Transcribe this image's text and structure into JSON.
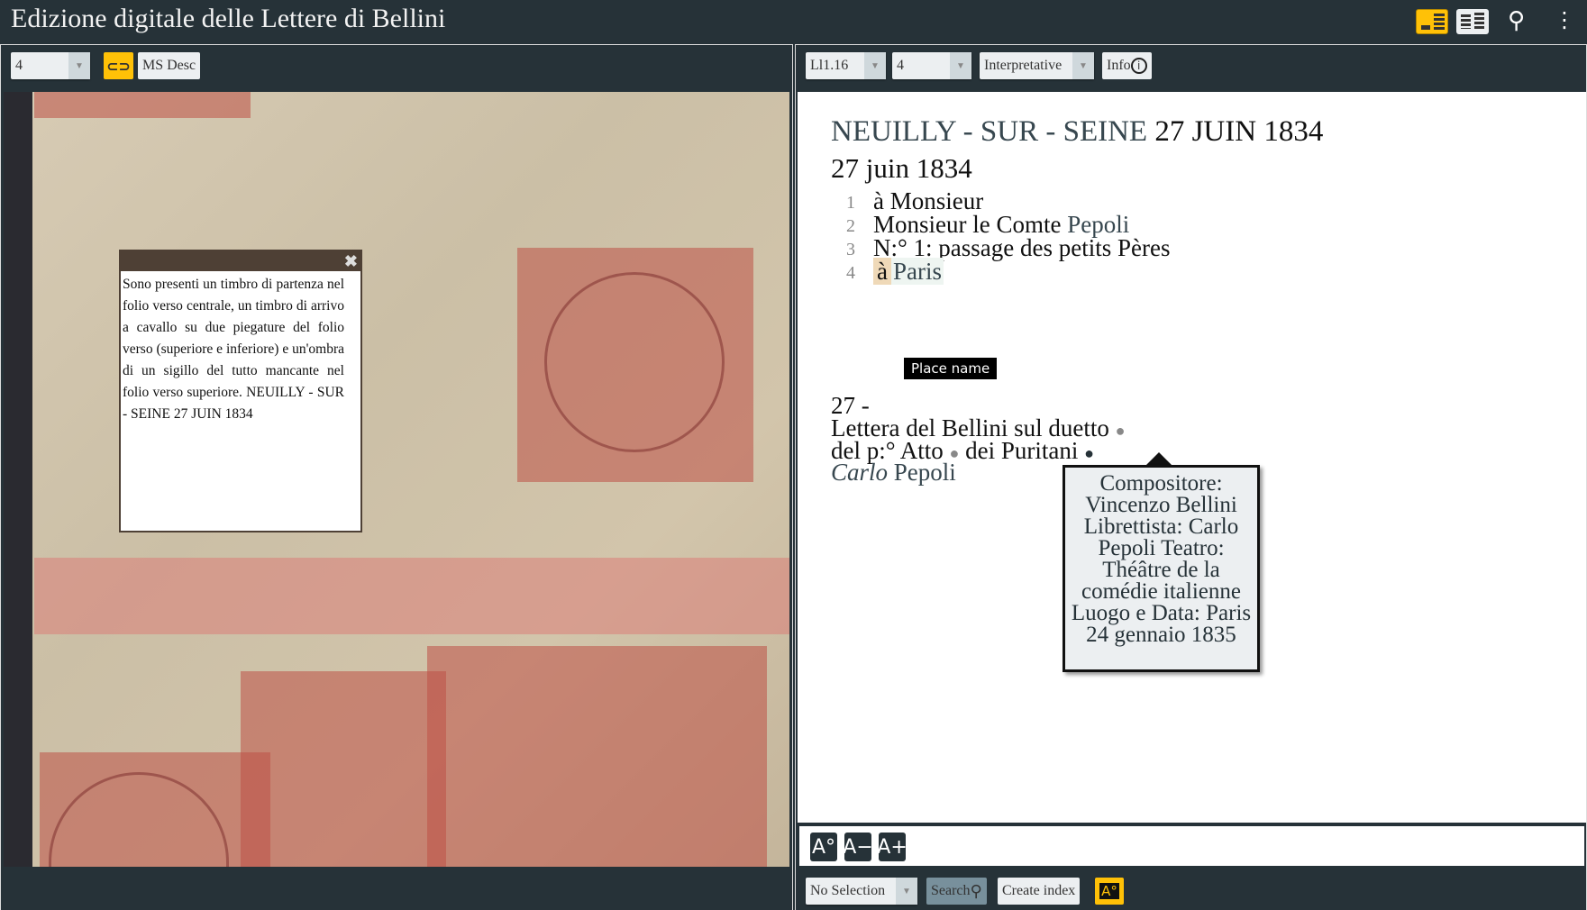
{
  "header": {
    "title": "Edizione digitale delle Lettere di Bellini",
    "icons": [
      "image-text-view-icon",
      "text-text-view-icon",
      "search-icon",
      "more-vert-icon"
    ]
  },
  "left": {
    "page_select": "4",
    "link_icon": "link-icon",
    "ms_desc": "MS Desc",
    "popup": {
      "close": "✖",
      "text": "Sono presenti un timbro di partenza nel folio verso centrale, un timbro di arrivo a cavallo su due piegature del folio verso (superiore e inferiore) e un'ombra di un sigillo del tutto mancante nel folio verso superiore. NEUILLY - SUR - SEINE 27 JUIN 1834"
    }
  },
  "right": {
    "doc_select": "Ll1.16",
    "page_select": "4",
    "edition_select": "Interpretative",
    "info": "Info",
    "text": {
      "stamp_place": "NEUILLY - SUR - SEINE",
      "stamp_date": "27 JUIN 1834",
      "date": "27 juin 1834",
      "lines": [
        {
          "n": "1",
          "pre": "à Monsieur",
          "ent": ""
        },
        {
          "n": "2",
          "pre": "Monsieur le Comte ",
          "ent": "Pepoli"
        },
        {
          "n": "3",
          "pre": "N:° 1: passage des petits Pères",
          "ent": ""
        },
        {
          "n": "4",
          "pre": "à",
          "ent": "Paris"
        }
      ],
      "tooltip": "Place name",
      "note1": "27 -",
      "note2": "Lettera del Bellini sul duetto",
      "note3a": "del p:° Atto",
      "note3b": "dei Puritani",
      "note4a": "Carlo",
      "note4b": " Pepoli",
      "popover": "Compositore: Vincenzo Bellini Librettista: Carlo Pepoli Teatro: Théâtre de la comédie italienne Luogo e Data: Paris 24 gennaio 1835"
    },
    "font_buttons": [
      "A°",
      "A−",
      "A+"
    ],
    "bottom": {
      "entity_select": "No Selection",
      "search": "Search",
      "create_index": "Create index"
    }
  },
  "colors": {
    "accent": "#ffc107",
    "bg": "#263238"
  }
}
